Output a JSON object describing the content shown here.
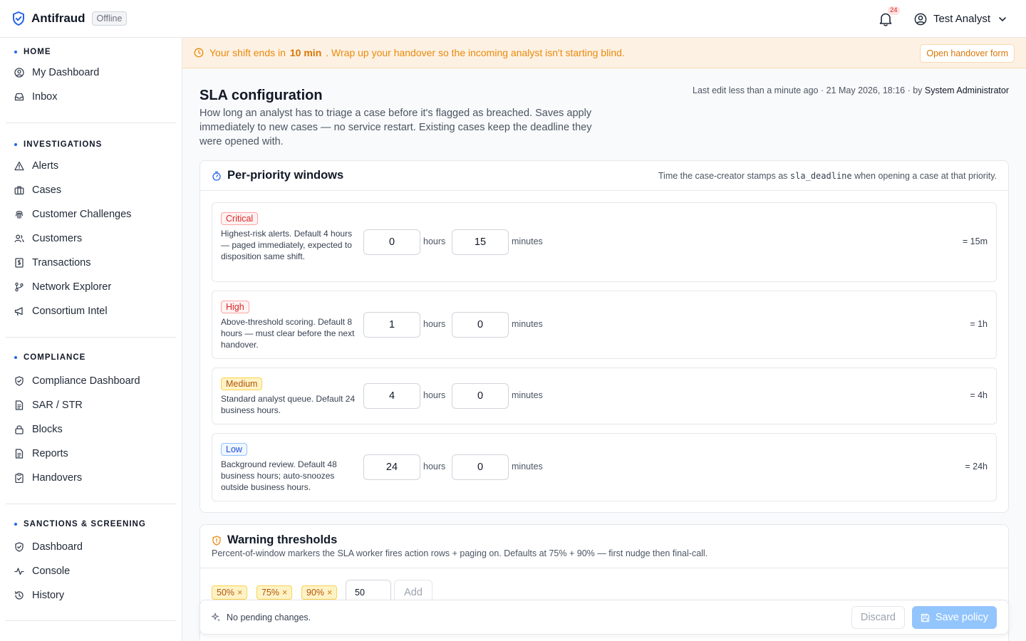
{
  "app": {
    "title": "Antifraud",
    "status_badge": "Offline"
  },
  "header": {
    "notification_count": "24",
    "user_name": "Test Analyst"
  },
  "sidebar": {
    "home": {
      "heading": "HOME",
      "items": [
        "My Dashboard",
        "Inbox"
      ]
    },
    "investigations": {
      "heading": "INVESTIGATIONS",
      "items": [
        "Alerts",
        "Cases",
        "Customer Challenges",
        "Customers",
        "Transactions",
        "Network Explorer",
        "Consortium Intel"
      ]
    },
    "compliance": {
      "heading": "COMPLIANCE",
      "items": [
        "Compliance Dashboard",
        "SAR / STR",
        "Blocks",
        "Reports",
        "Handovers"
      ]
    },
    "sanctions": {
      "heading": "SANCTIONS & SCREENING",
      "items": [
        "Dashboard",
        "Console",
        "History"
      ]
    }
  },
  "banner": {
    "text_prefix": "Your shift ends in",
    "time": "10 min",
    "text_suffix": ". Wrap up your handover so the incoming analyst isn't starting blind.",
    "button": "Open handover form"
  },
  "page": {
    "title": "SLA configuration",
    "description": "How long an analyst has to triage a case before it's flagged as breached. Saves apply immediately to new cases — no service restart. Existing cases keep the deadline they were opened with.",
    "last_edit_prefix": "Last edit less than a minute ago · 21 May 2026, 18:16 · by",
    "last_edit_by": "System Administrator"
  },
  "windows": {
    "title": "Per-priority windows",
    "note_prefix": "Time the case-creator stamps as",
    "note_code": "sla_deadline",
    "note_suffix": "when opening a case at that priority.",
    "hours_label": "hours",
    "minutes_label": "minutes",
    "priorities": [
      {
        "label": "Critical",
        "description": "Highest-risk alerts. Default 4 hours — paged immediately, expected to disposition same shift.",
        "hours": "0",
        "minutes": "15",
        "total": "= 15m"
      },
      {
        "label": "High",
        "description": "Above-threshold scoring. Default 8 hours — must clear before the next handover.",
        "hours": "1",
        "minutes": "0",
        "total": "= 1h"
      },
      {
        "label": "Medium",
        "description": "Standard analyst queue. Default 24 business hours.",
        "hours": "4",
        "minutes": "0",
        "total": "= 4h"
      },
      {
        "label": "Low",
        "description": "Background review. Default 48 business hours; auto-snoozes outside business hours.",
        "hours": "24",
        "minutes": "0",
        "total": "= 24h"
      }
    ]
  },
  "thresholds": {
    "title": "Warning thresholds",
    "description": "Percent-of-window markers the SLA worker fires action rows + paging on. Defaults at 75% + 90% — first nudge then final-call.",
    "chips": [
      "50%",
      "75%",
      "90%"
    ],
    "remove_glyph": "×",
    "input_value": "50",
    "add_button": "Add"
  },
  "actionbar": {
    "status": "No pending changes.",
    "discard": "Discard",
    "save": "Save policy"
  },
  "colors": {
    "accent": "#2563eb",
    "warning": "#ea8a0c",
    "critical": "#dc2626",
    "medium": "#b45309",
    "low": "#1d4ed8"
  }
}
